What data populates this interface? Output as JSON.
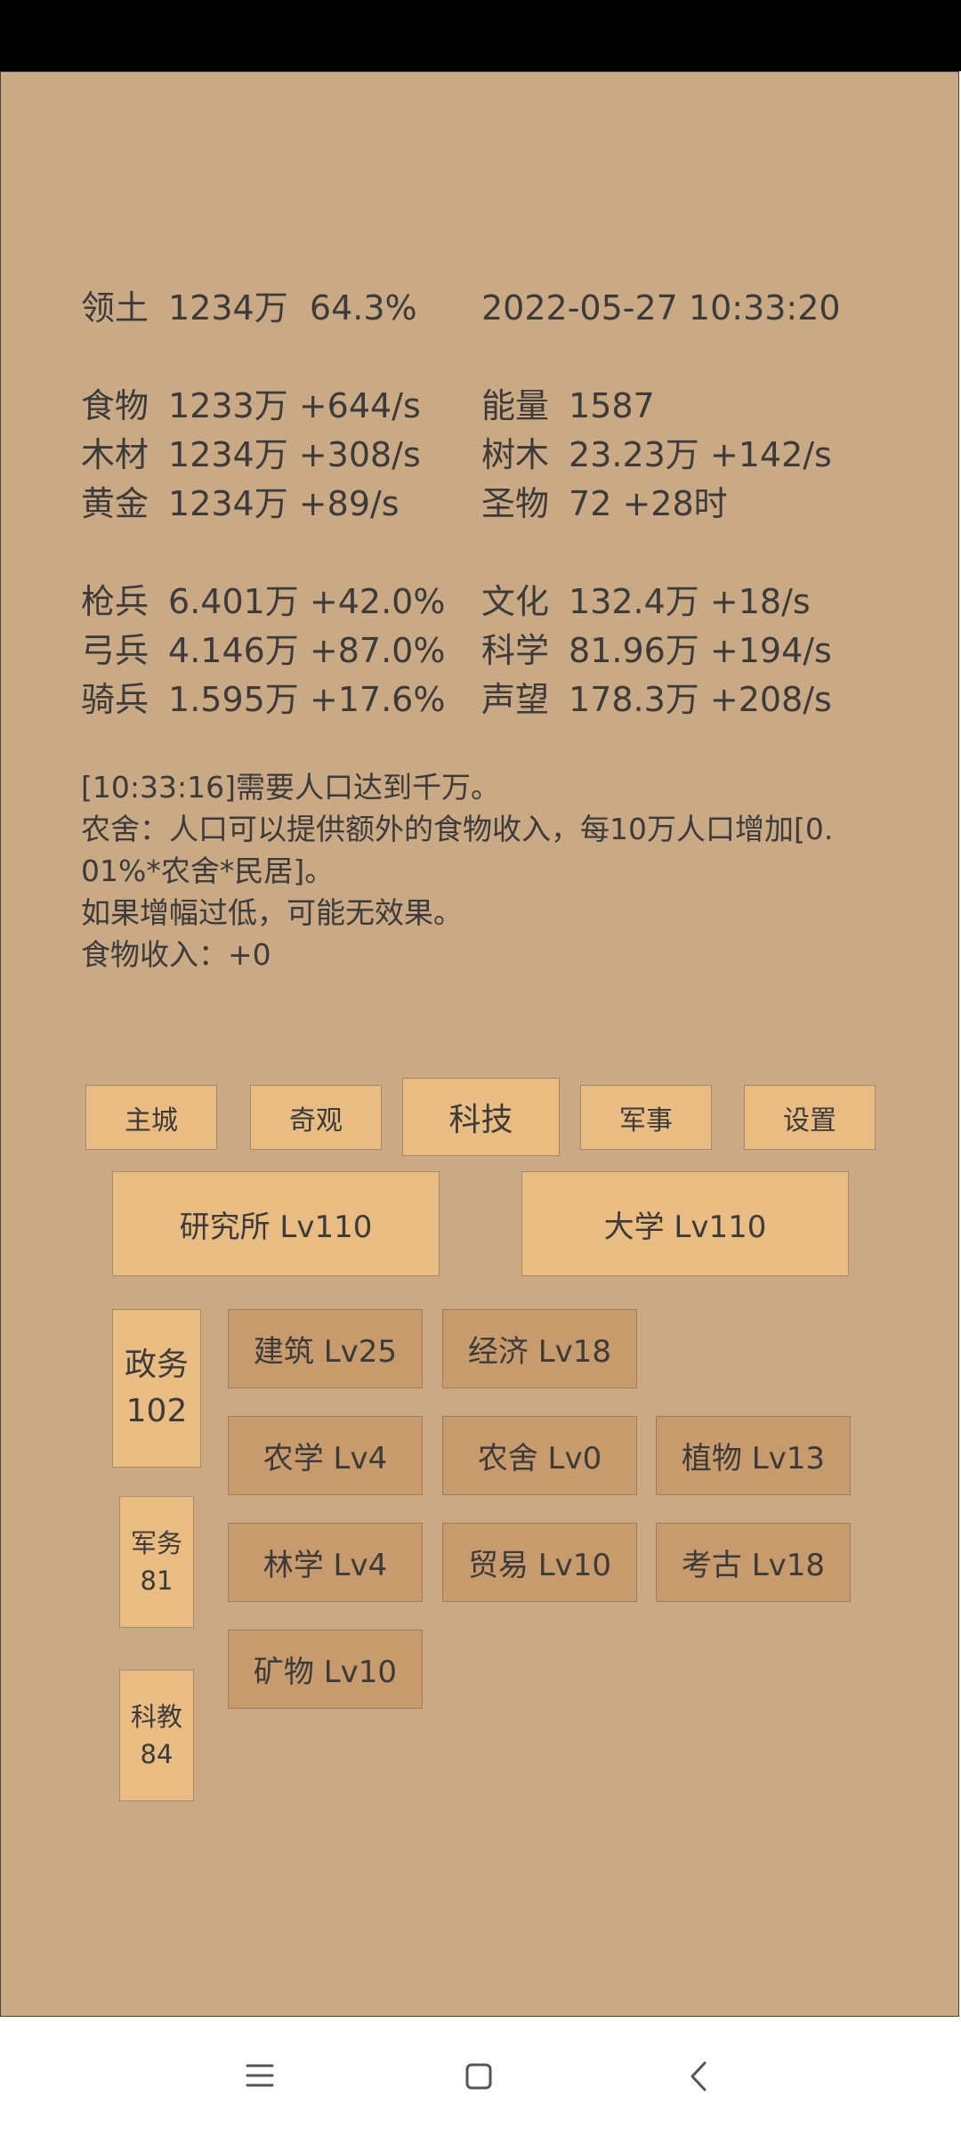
{
  "stats": {
    "territory": {
      "label": "领土",
      "value": "1234万",
      "percent": "64.3%"
    },
    "datetime": "2022-05-27 10:33:20",
    "food": {
      "label": "食物",
      "value": "1233万 +644/s"
    },
    "wood": {
      "label": "木材",
      "value": "1234万 +308/s"
    },
    "gold": {
      "label": "黄金",
      "value": "1234万 +89/s"
    },
    "energy": {
      "label": "能量",
      "value": "1587"
    },
    "trees": {
      "label": "树木",
      "value": "23.23万 +142/s"
    },
    "relics": {
      "label": "圣物",
      "value": "72 +28时"
    },
    "spearmen": {
      "label": "枪兵",
      "value": "6.401万 +42.0%"
    },
    "archers": {
      "label": "弓兵",
      "value": "4.146万 +87.0%"
    },
    "cavalry": {
      "label": "骑兵",
      "value": "1.595万 +17.6%"
    },
    "culture": {
      "label": "文化",
      "value": "132.4万 +18/s"
    },
    "science": {
      "label": "科学",
      "value": "81.96万 +194/s"
    },
    "prestige": {
      "label": "声望",
      "value": "178.3万 +208/s"
    }
  },
  "message": {
    "line1": "[10:33:16]需要人口达到千万。",
    "line2": "农舍：人口可以提供额外的食物收入，每10万人口增加[0.",
    "line3": "01%*农舍*民居]。",
    "line4": "如果增幅过低，可能无效果。",
    "line5": "食物收入：+0"
  },
  "tabs": {
    "main_city": "主城",
    "wonders": "奇观",
    "tech": "科技",
    "military": "军事",
    "settings": "设置"
  },
  "buildings": {
    "institute": "研究所 Lv110",
    "university": "大学 Lv110"
  },
  "categories": {
    "politics": {
      "label": "政务",
      "value": "102"
    },
    "military": {
      "label": "军务",
      "value": "81"
    },
    "education": {
      "label": "科教",
      "value": "84"
    }
  },
  "techs": {
    "architecture": "建筑 Lv25",
    "economy": "经济 Lv18",
    "agronomy": "农学 Lv4",
    "farmhouse": "农舍 Lv0",
    "plants": "植物 Lv13",
    "forestry": "林学 Lv4",
    "trade": "贸易 Lv10",
    "archaeology": "考古 Lv18",
    "minerals": "矿物 Lv10"
  },
  "colors": {
    "background": "#caaa84",
    "button": "#e9bd82",
    "tech_button": "#c79b6b",
    "text": "#3b3b3b"
  },
  "nav_icons": [
    "menu-icon",
    "home-icon",
    "back-icon"
  ]
}
